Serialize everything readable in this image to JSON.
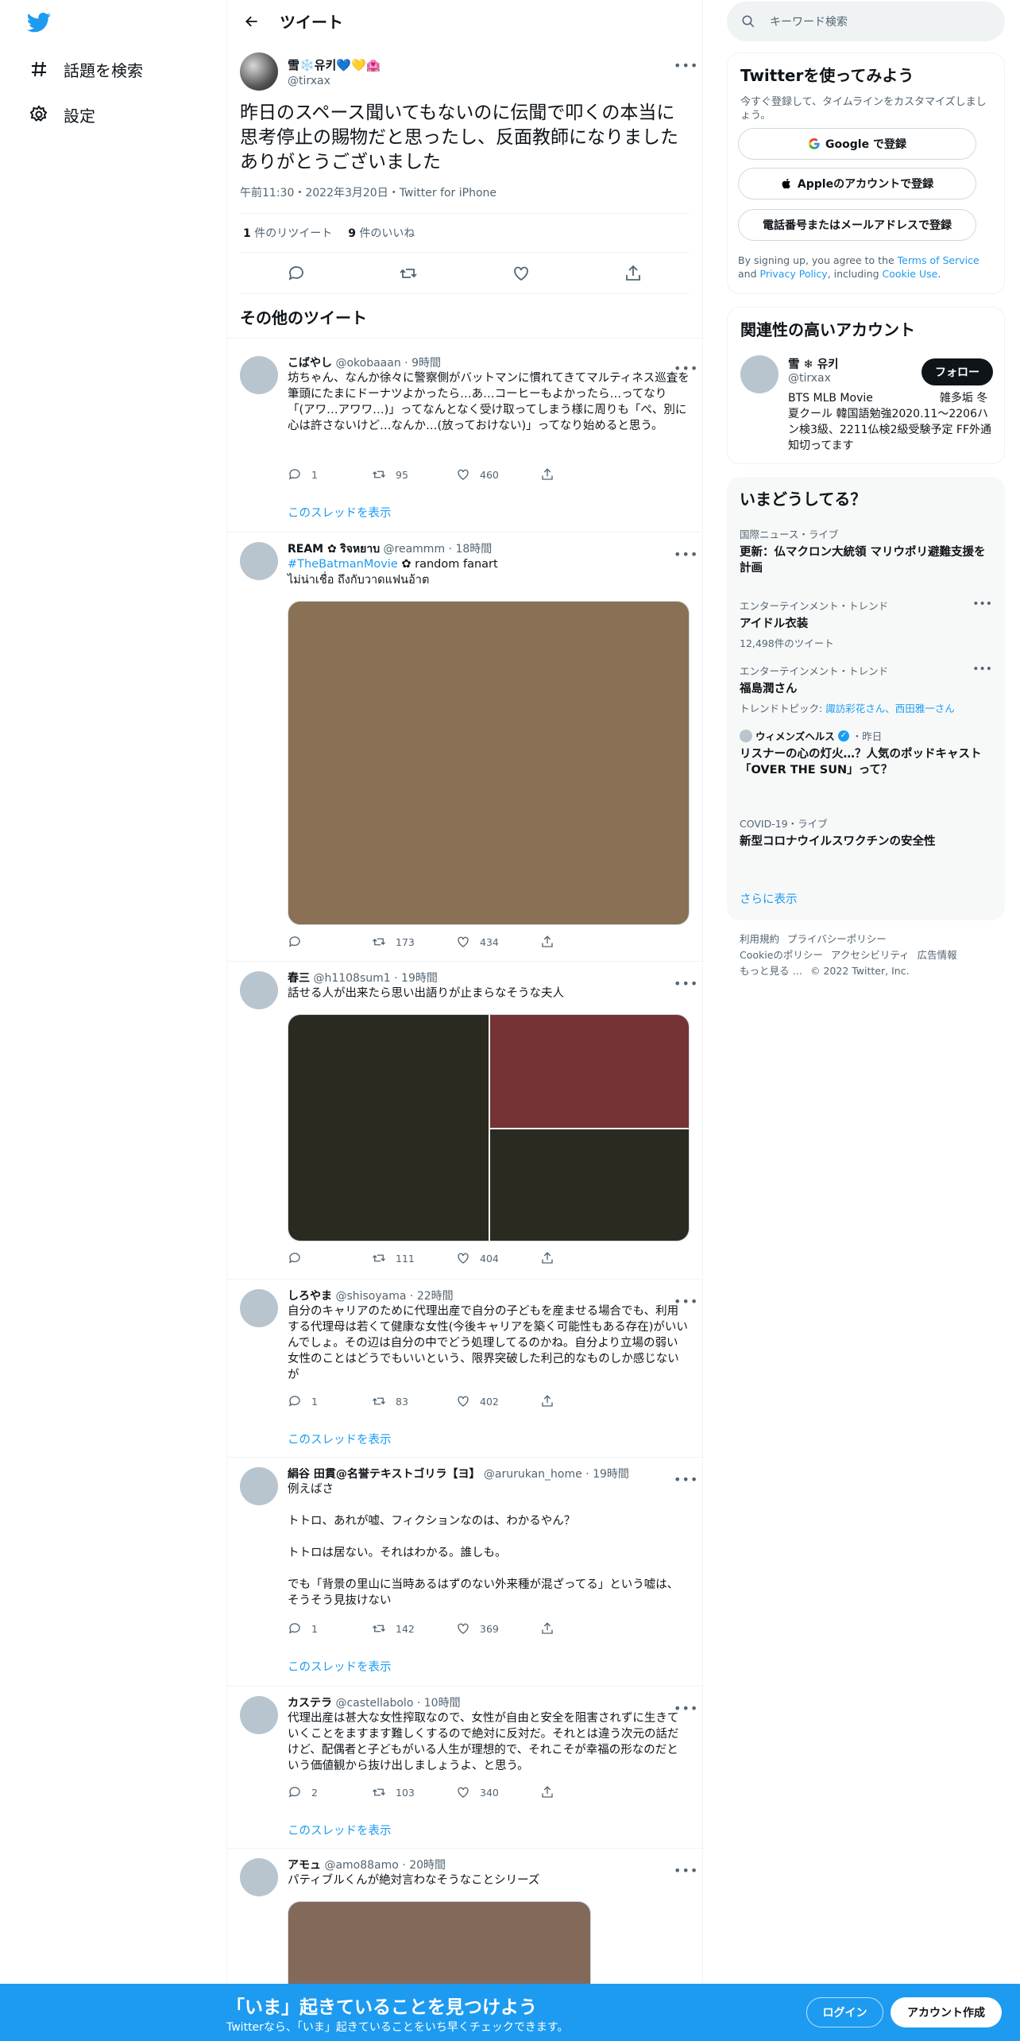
{
  "nav": {
    "explore_label": "話題を検索",
    "settings_label": "設定"
  },
  "header": {
    "title": "ツイート"
  },
  "main_tweet": {
    "name": "雪❄️유키💙💛🏩",
    "handle": "@tirxax",
    "text": "昨日のスペース聞いてもないのに伝聞で叩くの本当に思考停止の賜物だと思ったし、反面教師になりました\nありがとうございました",
    "meta": "午前11:30・2022年3月20日・Twitter for iPhone",
    "retweets_count": "1",
    "retweets_label": " 件のリツイート",
    "likes_count": "9",
    "likes_label": " 件のいいね"
  },
  "other_tweets_title": "その他のツイート",
  "show_thread_label": "このスレッドを表示",
  "tweets": [
    {
      "name": "こばやし",
      "handle": "@okobaaan",
      "time": "9時間",
      "text": "坊ちゃん、なんか徐々に警察側がバットマンに慣れてきてマルティネス巡査を筆頭にたまにドーナツよかったら…あ…コーヒーもよかったら…ってなり「(アワ…アワワ…)」ってなんとなく受け取ってしまう様に周りも「ぺ、別に心は許さないけど…なんか…(放っておけない)」ってなり始めると思う。",
      "reply": "1",
      "retweet": "95",
      "like": "460"
    },
    {
      "name": "REAM ✿",
      "name2": "ริจหยาบ",
      "handle": "@reammm",
      "time": "18時間",
      "tag": "#TheBatmanMovie",
      "text_after_tag": "random fanart",
      "text2": "ไม่น่าเชื่อ ถึงกับวาดแฟนอ้าต",
      "reply": "",
      "retweet": "173",
      "like": "434"
    },
    {
      "name": "春三",
      "handle": "@h1108sum1",
      "time": "19時間",
      "text": "話せる人が出来たら思い出語りが止まらなそうな夫人",
      "reply": "",
      "retweet": "111",
      "like": "404"
    },
    {
      "name": "しろやま",
      "handle": "@shisoyama",
      "time": "22時間",
      "text": "自分のキャリアのために代理出産で自分の子どもを産ませる場合でも、利用する代理母は若くて健康な女性(今後キャリアを築く可能性もある存在)がいいんでしょ。その辺は自分の中でどう処理してるのかね。自分より立場の弱い女性のことはどうでもいいという、限界突破した利己的なものしか感じないが",
      "reply": "1",
      "retweet": "83",
      "like": "402"
    },
    {
      "name": "絹谷 田貫@名誉テキストゴリラ【ヨ】",
      "handle": "@arurukan_home",
      "time": "19時間",
      "text": "例えばさ\n\nトトロ、あれが嘘、フィクションなのは、わかるやん？\n\nトトロは居ない。それはわかる。誰しも。\n\nでも「背景の里山に当時あるはずのない外来種が混ざってる」という嘘は、そうそう見抜けない",
      "reply": "1",
      "retweet": "142",
      "like": "369"
    },
    {
      "name": "カステラ",
      "handle": "@castellabolo",
      "time": "10時間",
      "text": "代理出産は甚大な女性搾取なので、女性が自由と安全を阻害されずに生きていくことをますます難しくするので絶対に反対だ。それとは違う次元の話だけど、配偶者と子どもがいる人生が理想的で、それこそが幸福の形なのだという価値観から抜け出しましょうよ、と思う。",
      "reply": "2",
      "retweet": "103",
      "like": "340"
    },
    {
      "name": "アモュ",
      "handle": "@amo88amo",
      "time": "20時間",
      "text": "パティブルくんが絶対言わなそうなことシリーズ"
    }
  ],
  "right": {
    "search_placeholder": "キーワード検索",
    "signup": {
      "title": "Twitterを使ってみよう",
      "subtitle": "今すぐ登録して、タイムラインをカスタマイズしましょう。",
      "google": "Google で登録",
      "apple": "Appleのアカウントで登録",
      "phone": "電話番号またはメールアドレスで登録",
      "terms_1": "By signing up, you agree to the ",
      "terms_link1": "Terms of Service",
      "terms_2": " and ",
      "terms_link2": "Privacy Policy",
      "terms_3": ", including ",
      "terms_link3": "Cookie Use",
      "terms_4": "."
    },
    "related": {
      "title": "関連性の高いアカウント",
      "name": "雪 ❄ 유키",
      "handle": "@tirxax",
      "follow": "フォロー",
      "bio": "BTS MLB Movie　　　　　　雑多垢 冬夏クール 韓国語勉強2020.11〜2206ハン検3級、2211仏検2級受験予定 FF外通知切ってます"
    },
    "trends": {
      "title": "いまどうしてる？",
      "items": [
        {
          "category": "国際ニュース・ライブ",
          "title": "更新：仏マクロン大統領 マリウポリ避難支援を計画"
        },
        {
          "category": "エンターテインメント・トレンド",
          "title": "アイドル衣装",
          "sub": "12,498件のツイート"
        },
        {
          "category": "エンターテインメント・トレンド",
          "title": "福島潤さん",
          "sub_prefix": "トレンドトピック: ",
          "sub_link": "諏訪彩花さん、西田雅一さん"
        },
        {
          "category": "ウィメンズヘルス",
          "category_suffix": "・昨日",
          "title": "リスナーの心の灯火…？人気のポッドキャスト「OVER THE SUN」って？"
        },
        {
          "category": "COVID-19・ライブ",
          "title": "新型コロナウイルスワクチンの安全性"
        }
      ],
      "show_more": "さらに表示"
    },
    "footer": {
      "line1": [
        "利用規約",
        "プライバシーポリシー"
      ],
      "line2": [
        "Cookieのポリシー",
        "アクセシビリティ",
        "広告情報"
      ],
      "more": "もっと見る …",
      "copyright": "© 2022 Twitter, Inc."
    }
  },
  "bottom": {
    "title": "「いま」起きていることを見つけよう",
    "subtitle": "Twitterなら、「いま」起きていることをいち早くチェックできます。",
    "login": "ログイン",
    "signup": "アカウント作成"
  },
  "colors": {
    "brand": "#1d9bf0",
    "text": "#0f1419",
    "secondary": "#536471"
  }
}
